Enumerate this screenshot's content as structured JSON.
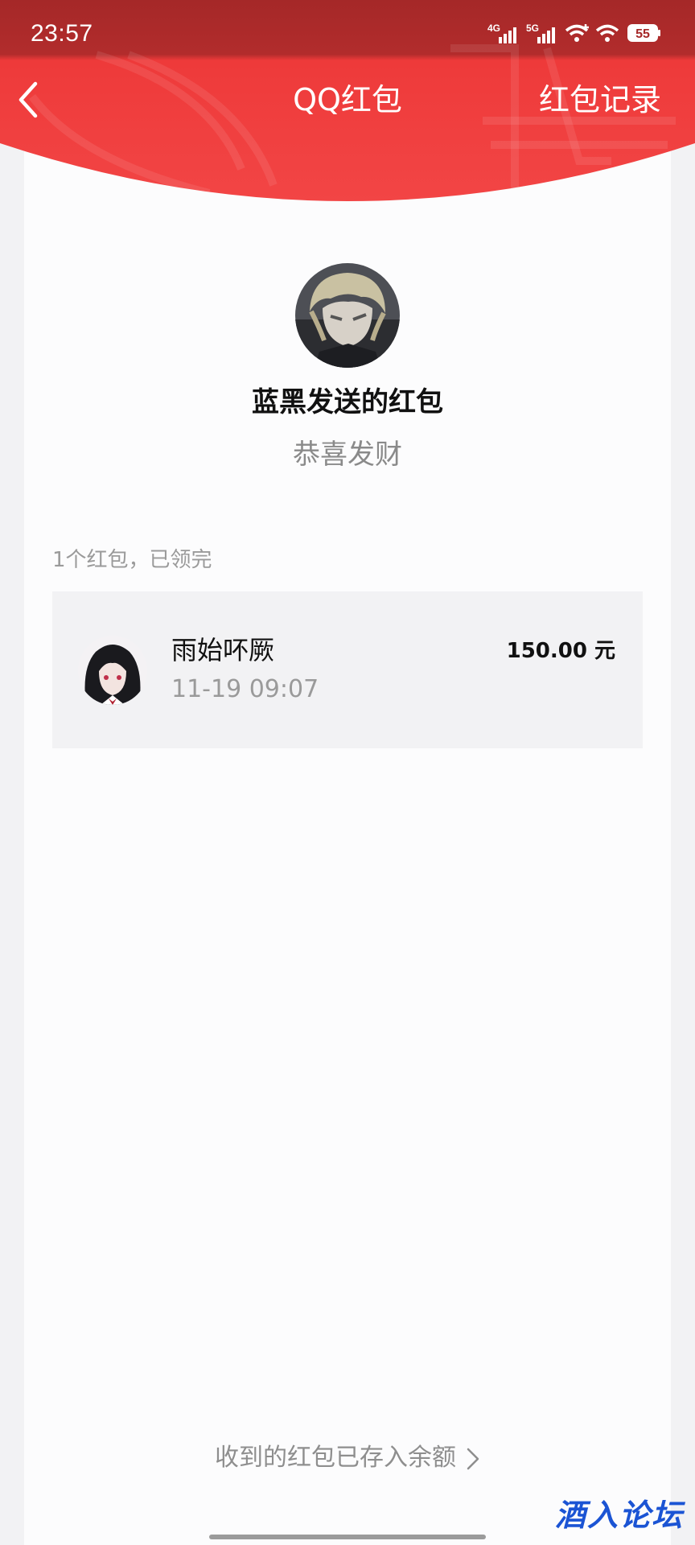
{
  "status_bar": {
    "time": "23:57",
    "network_1": "4G",
    "network_2": "5G",
    "battery": "55"
  },
  "nav": {
    "title": "QQ红包",
    "records_label": "红包记录"
  },
  "sender": {
    "title": "蓝黑发送的红包",
    "blessing": "恭喜发财"
  },
  "summary": "1个红包，已领完",
  "records": [
    {
      "name": "雨始吥厥",
      "time": "11-19 09:07",
      "amount": "150.00 元"
    }
  ],
  "footer": {
    "link_label": "收到的红包已存入余额"
  },
  "watermark": "酒入论坛",
  "colors": {
    "header_red": "#ef3a3a",
    "status_red": "#a6292a",
    "footer_text": "#8e8e8e"
  }
}
